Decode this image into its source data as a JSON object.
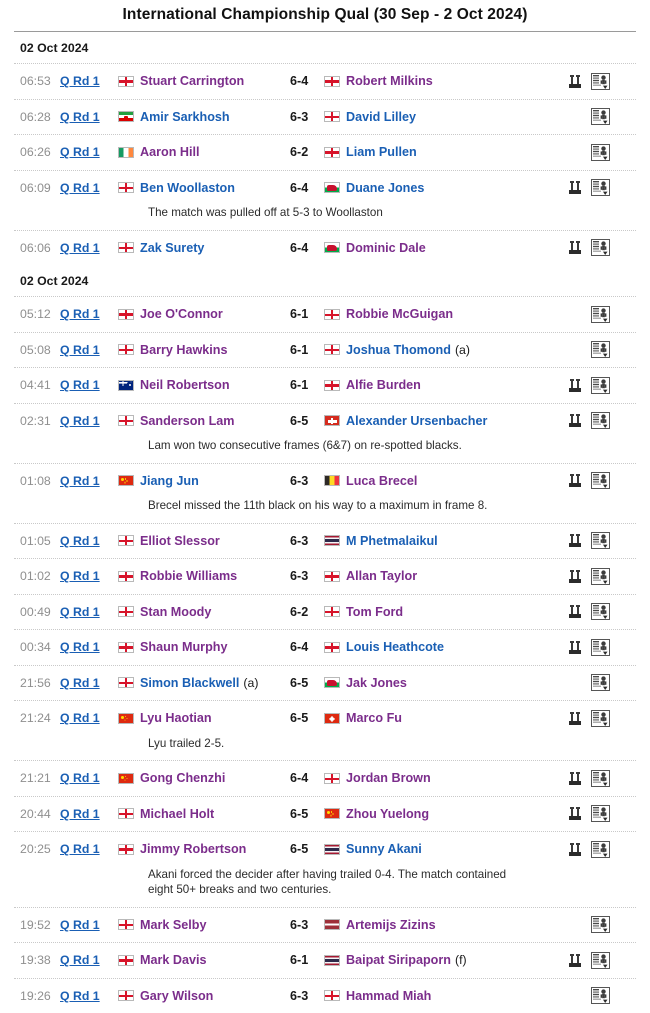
{
  "header": {
    "title": "International Championship Qual (30 Sep - 2 Oct 2024)"
  },
  "icons": {
    "people": "people-icon",
    "scorecard": "scorecard-icon"
  },
  "groups": [
    {
      "date": "02 Oct 2024",
      "matches": [
        {
          "time": "06:53",
          "round": "Q Rd 1",
          "p1": {
            "name": "Stuart Carrington",
            "flag": "eng",
            "result": "win",
            "tag": ""
          },
          "score": "6-4",
          "p2": {
            "name": "Robert Milkins",
            "flag": "eng",
            "result": "win",
            "tag": ""
          },
          "has_people_icon": true,
          "has_card_icon": true,
          "note": ""
        },
        {
          "time": "06:28",
          "round": "Q Rd 1",
          "p1": {
            "name": "Amir Sarkhosh",
            "flag": "irn",
            "result": "lose",
            "tag": ""
          },
          "score": "6-3",
          "p2": {
            "name": "David Lilley",
            "flag": "eng",
            "result": "lose",
            "tag": ""
          },
          "has_people_icon": false,
          "has_card_icon": true,
          "note": ""
        },
        {
          "time": "06:26",
          "round": "Q Rd 1",
          "p1": {
            "name": "Aaron Hill",
            "flag": "irl",
            "result": "win",
            "tag": ""
          },
          "score": "6-2",
          "p2": {
            "name": "Liam Pullen",
            "flag": "eng",
            "result": "lose",
            "tag": ""
          },
          "has_people_icon": false,
          "has_card_icon": true,
          "note": ""
        },
        {
          "time": "06:09",
          "round": "Q Rd 1",
          "p1": {
            "name": "Ben Woollaston",
            "flag": "eng",
            "result": "lose",
            "tag": ""
          },
          "score": "6-4",
          "p2": {
            "name": "Duane Jones",
            "flag": "wal",
            "result": "lose",
            "tag": ""
          },
          "has_people_icon": true,
          "has_card_icon": true,
          "note": "The match was pulled off at 5-3 to Woollaston"
        },
        {
          "time": "06:06",
          "round": "Q Rd 1",
          "p1": {
            "name": "Zak Surety",
            "flag": "eng",
            "result": "lose",
            "tag": ""
          },
          "score": "6-4",
          "p2": {
            "name": "Dominic Dale",
            "flag": "wal",
            "result": "win",
            "tag": ""
          },
          "has_people_icon": true,
          "has_card_icon": true,
          "note": ""
        }
      ]
    },
    {
      "date": "02 Oct 2024",
      "matches": [
        {
          "time": "05:12",
          "round": "Q Rd 1",
          "p1": {
            "name": "Joe O'Connor",
            "flag": "eng",
            "result": "win",
            "tag": ""
          },
          "score": "6-1",
          "p2": {
            "name": "Robbie McGuigan",
            "flag": "nir",
            "result": "win",
            "tag": ""
          },
          "has_people_icon": false,
          "has_card_icon": true,
          "note": ""
        },
        {
          "time": "05:08",
          "round": "Q Rd 1",
          "p1": {
            "name": "Barry Hawkins",
            "flag": "eng",
            "result": "win",
            "tag": ""
          },
          "score": "6-1",
          "p2": {
            "name": "Joshua Thomond",
            "flag": "eng",
            "result": "lose",
            "tag": "(a)"
          },
          "has_people_icon": false,
          "has_card_icon": true,
          "note": ""
        },
        {
          "time": "04:41",
          "round": "Q Rd 1",
          "p1": {
            "name": "Neil Robertson",
            "flag": "aus",
            "result": "win",
            "tag": ""
          },
          "score": "6-1",
          "p2": {
            "name": "Alfie Burden",
            "flag": "eng",
            "result": "win",
            "tag": ""
          },
          "has_people_icon": true,
          "has_card_icon": true,
          "note": ""
        },
        {
          "time": "02:31",
          "round": "Q Rd 1",
          "p1": {
            "name": "Sanderson Lam",
            "flag": "eng",
            "result": "win",
            "tag": ""
          },
          "score": "6-5",
          "p2": {
            "name": "Alexander Ursenbacher",
            "flag": "sui",
            "result": "lose",
            "tag": ""
          },
          "has_people_icon": true,
          "has_card_icon": true,
          "note": "Lam won two consecutive frames (6&7) on re-spotted blacks."
        },
        {
          "time": "01:08",
          "round": "Q Rd 1",
          "p1": {
            "name": "Jiang Jun",
            "flag": "chn",
            "result": "lose",
            "tag": ""
          },
          "score": "6-3",
          "p2": {
            "name": "Luca Brecel",
            "flag": "bel",
            "result": "win",
            "tag": ""
          },
          "has_people_icon": true,
          "has_card_icon": true,
          "note": "Brecel missed the 11th black on his way to a maximum in frame 8."
        },
        {
          "time": "01:05",
          "round": "Q Rd 1",
          "p1": {
            "name": "Elliot Slessor",
            "flag": "eng",
            "result": "win",
            "tag": ""
          },
          "score": "6-3",
          "p2": {
            "name": "M Phetmalaikul",
            "flag": "tha",
            "result": "lose",
            "tag": ""
          },
          "has_people_icon": true,
          "has_card_icon": true,
          "note": ""
        },
        {
          "time": "01:02",
          "round": "Q Rd 1",
          "p1": {
            "name": "Robbie Williams",
            "flag": "eng",
            "result": "win",
            "tag": ""
          },
          "score": "6-3",
          "p2": {
            "name": "Allan Taylor",
            "flag": "eng",
            "result": "win",
            "tag": ""
          },
          "has_people_icon": true,
          "has_card_icon": true,
          "note": ""
        },
        {
          "time": "00:49",
          "round": "Q Rd 1",
          "p1": {
            "name": "Stan Moody",
            "flag": "eng",
            "result": "win",
            "tag": ""
          },
          "score": "6-2",
          "p2": {
            "name": "Tom Ford",
            "flag": "eng",
            "result": "win",
            "tag": ""
          },
          "has_people_icon": true,
          "has_card_icon": true,
          "note": ""
        },
        {
          "time": "00:34",
          "round": "Q Rd 1",
          "p1": {
            "name": "Shaun Murphy",
            "flag": "eng",
            "result": "win",
            "tag": ""
          },
          "score": "6-4",
          "p2": {
            "name": "Louis Heathcote",
            "flag": "eng",
            "result": "lose",
            "tag": ""
          },
          "has_people_icon": true,
          "has_card_icon": true,
          "note": ""
        },
        {
          "time": "21:56",
          "round": "Q Rd 1",
          "p1": {
            "name": "Simon Blackwell",
            "flag": "eng",
            "result": "lose",
            "tag": "(a)"
          },
          "score": "6-5",
          "p2": {
            "name": "Jak Jones",
            "flag": "wal",
            "result": "win",
            "tag": ""
          },
          "has_people_icon": false,
          "has_card_icon": true,
          "note": ""
        },
        {
          "time": "21:24",
          "round": "Q Rd 1",
          "p1": {
            "name": "Lyu Haotian",
            "flag": "chn",
            "result": "win",
            "tag": ""
          },
          "score": "6-5",
          "p2": {
            "name": "Marco Fu",
            "flag": "hkg",
            "result": "win",
            "tag": ""
          },
          "has_people_icon": true,
          "has_card_icon": true,
          "note": "Lyu trailed 2-5."
        },
        {
          "time": "21:21",
          "round": "Q Rd 1",
          "p1": {
            "name": "Gong Chenzhi",
            "flag": "chn",
            "result": "win",
            "tag": ""
          },
          "score": "6-4",
          "p2": {
            "name": "Jordan Brown",
            "flag": "nir",
            "result": "win",
            "tag": ""
          },
          "has_people_icon": true,
          "has_card_icon": true,
          "note": ""
        },
        {
          "time": "20:44",
          "round": "Q Rd 1",
          "p1": {
            "name": "Michael Holt",
            "flag": "eng",
            "result": "win",
            "tag": ""
          },
          "score": "6-5",
          "p2": {
            "name": "Zhou Yuelong",
            "flag": "chn",
            "result": "win",
            "tag": ""
          },
          "has_people_icon": true,
          "has_card_icon": true,
          "note": ""
        },
        {
          "time": "20:25",
          "round": "Q Rd 1",
          "p1": {
            "name": "Jimmy Robertson",
            "flag": "eng",
            "result": "win",
            "tag": ""
          },
          "score": "6-5",
          "p2": {
            "name": "Sunny Akani",
            "flag": "tha",
            "result": "lose",
            "tag": ""
          },
          "has_people_icon": true,
          "has_card_icon": true,
          "note": "Akani forced the decider after having trailed 0-4. The match contained eight 50+ breaks and two centuries."
        },
        {
          "time": "19:52",
          "round": "Q Rd 1",
          "p1": {
            "name": "Mark Selby",
            "flag": "eng",
            "result": "win",
            "tag": ""
          },
          "score": "6-3",
          "p2": {
            "name": "Artemijs Zizins",
            "flag": "lva",
            "result": "win",
            "tag": ""
          },
          "has_people_icon": false,
          "has_card_icon": true,
          "note": ""
        },
        {
          "time": "19:38",
          "round": "Q Rd 1",
          "p1": {
            "name": "Mark Davis",
            "flag": "eng",
            "result": "win",
            "tag": ""
          },
          "score": "6-1",
          "p2": {
            "name": "Baipat Siripaporn",
            "flag": "tha",
            "result": "win",
            "tag": "(f)"
          },
          "has_people_icon": true,
          "has_card_icon": true,
          "note": ""
        },
        {
          "time": "19:26",
          "round": "Q Rd 1",
          "p1": {
            "name": "Gary Wilson",
            "flag": "eng",
            "result": "win",
            "tag": ""
          },
          "score": "6-3",
          "p2": {
            "name": "Hammad Miah",
            "flag": "eng",
            "result": "win",
            "tag": ""
          },
          "has_people_icon": false,
          "has_card_icon": true,
          "note": ""
        }
      ]
    }
  ]
}
